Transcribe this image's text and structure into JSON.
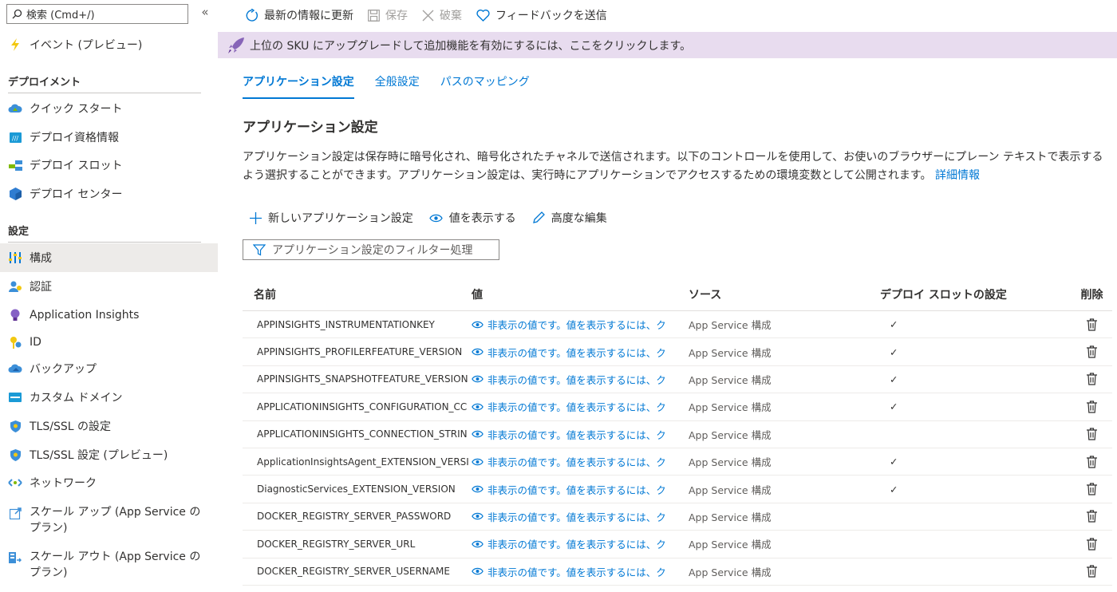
{
  "sidebar": {
    "search_placeholder": "検索 (Cmd+/)",
    "collapse_glyph": "«",
    "events_label": "イベント (プレビュー)",
    "section_deploy": "デプロイメント",
    "deploy_items": [
      "クイック スタート",
      "デプロイ資格情報",
      "デプロイ スロット",
      "デプロイ センター"
    ],
    "section_settings": "設定",
    "settings_items": [
      "構成",
      "認証",
      "Application Insights",
      "ID",
      "バックアップ",
      "カスタム ドメイン",
      "TLS/SSL の設定",
      "TLS/SSL 設定 (プレビュー)",
      "ネットワーク",
      "スケール アップ (App Service のプラン)",
      "スケール アウト (App Service のプラン)"
    ]
  },
  "cmdbar": {
    "refresh": "最新の情報に更新",
    "save": "保存",
    "discard": "破棄",
    "feedback": "フィードバックを送信"
  },
  "banner": {
    "text": "上位の SKU にアップグレードして追加機能を有効にするには、ここをクリックします。"
  },
  "tabs": [
    "アプリケーション設定",
    "全般設定",
    "パスのマッピング"
  ],
  "main": {
    "title": "アプリケーション設定",
    "description": "アプリケーション設定は保存時に暗号化され、暗号化されたチャネルで送信されます。以下のコントロールを使用して、お使いのブラウザーにプレーン テキストで表示するよう選択することができます。アプリケーション設定は、実行時にアプリケーションでアクセスするための環境変数として公開されます。",
    "learn_more": "詳細情報",
    "new_setting": "新しいアプリケーション設定",
    "show_values": "値を表示する",
    "advanced_edit": "高度な編集",
    "filter_placeholder": "アプリケーション設定のフィルター処理"
  },
  "table": {
    "headers": {
      "name": "名前",
      "value": "値",
      "source": "ソース",
      "slot": "デプロイ スロットの設定",
      "delete": "削除"
    },
    "hidden_value_text": "非表示の値です。値を表示するには、ク",
    "rows": [
      {
        "name": "APPINSIGHTS_INSTRUMENTATIONKEY",
        "source": "App Service 構成",
        "slot": "✓"
      },
      {
        "name": "APPINSIGHTS_PROFILERFEATURE_VERSION",
        "source": "App Service 構成",
        "slot": "✓"
      },
      {
        "name": "APPINSIGHTS_SNAPSHOTFEATURE_VERSION",
        "source": "App Service 構成",
        "slot": "✓"
      },
      {
        "name": "APPLICATIONINSIGHTS_CONFIGURATION_CC",
        "source": "App Service 構成",
        "slot": "✓"
      },
      {
        "name": "APPLICATIONINSIGHTS_CONNECTION_STRIN",
        "source": "App Service 構成",
        "slot": ""
      },
      {
        "name": "ApplicationInsightsAgent_EXTENSION_VERSI",
        "source": "App Service 構成",
        "slot": "✓"
      },
      {
        "name": "DiagnosticServices_EXTENSION_VERSION",
        "source": "App Service 構成",
        "slot": "✓"
      },
      {
        "name": "DOCKER_REGISTRY_SERVER_PASSWORD",
        "source": "App Service 構成",
        "slot": ""
      },
      {
        "name": "DOCKER_REGISTRY_SERVER_URL",
        "source": "App Service 構成",
        "slot": ""
      },
      {
        "name": "DOCKER_REGISTRY_SERVER_USERNAME",
        "source": "App Service 構成",
        "slot": ""
      }
    ]
  }
}
